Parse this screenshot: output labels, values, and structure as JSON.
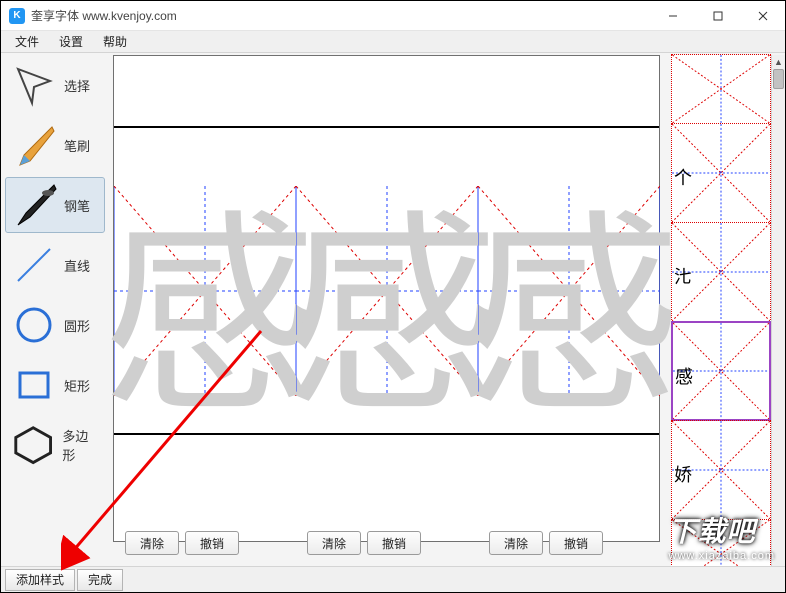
{
  "window": {
    "title": "奎享字体 www.kvenjoy.com",
    "icon_letter": "K"
  },
  "menu": {
    "file": "文件",
    "settings": "设置",
    "help": "帮助"
  },
  "tools": {
    "select": "选择",
    "brush": "笔刷",
    "pen": "钢笔",
    "line": "直线",
    "circle": "圆形",
    "rect": "矩形",
    "polygon": "多边形"
  },
  "canvas": {
    "glyph": "感",
    "clear": "清除",
    "undo": "撤销"
  },
  "thumbs": {
    "items": [
      "",
      "个",
      "㲺",
      "感",
      "娇",
      ""
    ]
  },
  "bottom": {
    "add_style": "添加样式",
    "finish": "完成"
  },
  "watermark": {
    "main": "下载吧",
    "sub": "www.xiazaiba.com"
  }
}
